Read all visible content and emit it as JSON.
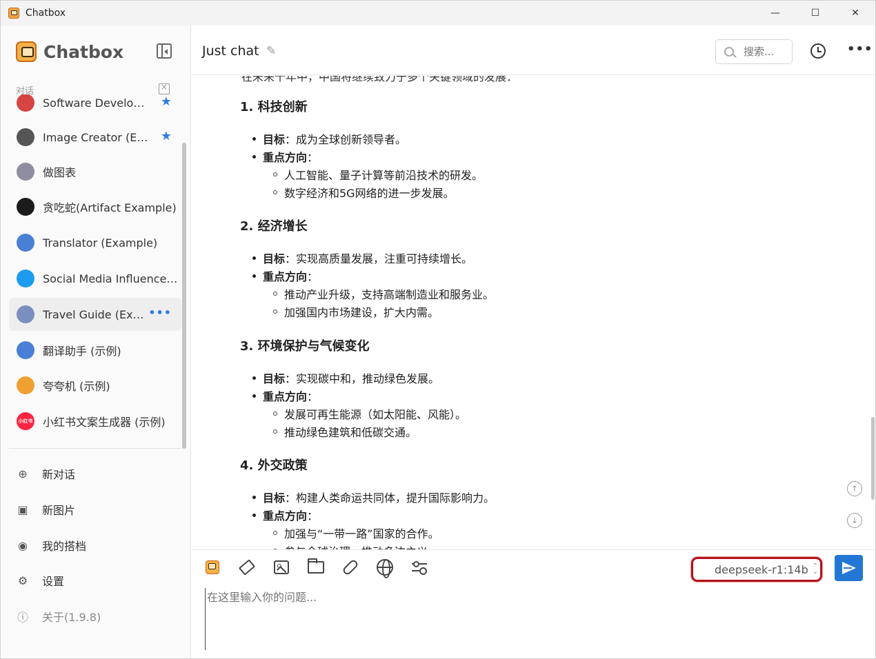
{
  "window": {
    "title": "Chatbox",
    "controls": {
      "minimize": "—",
      "maximize": "☐",
      "close": "✕"
    }
  },
  "sidebar": {
    "brand": "Chatbox",
    "section_label": "对话",
    "conversations": [
      {
        "label": "Software Develop…",
        "icon": "heart-icon",
        "color": "#d64541",
        "starred": true
      },
      {
        "label": "Image Creator (E…",
        "icon": "image-icon",
        "color": "#555555",
        "starred": true
      },
      {
        "label": "做图表",
        "icon": "chart-icon",
        "color": "#8e8ea0",
        "starred": false
      },
      {
        "label": "贪吃蛇(Artifact Example)",
        "icon": "snake-icon",
        "color": "#1b1b1b",
        "starred": false
      },
      {
        "label": "Translator (Example)",
        "icon": "translate-icon",
        "color": "#4a7fd6",
        "starred": false
      },
      {
        "label": "Social Media Influence…",
        "icon": "twitter-icon",
        "color": "#1d9bf0",
        "starred": false
      },
      {
        "label": "Travel Guide (Ex…",
        "icon": "globe-icon",
        "color": "#7a8fbf",
        "starred": false,
        "active": true,
        "more": "•••"
      },
      {
        "label": "翻译助手 (示例)",
        "icon": "translate-icon",
        "color": "#4a7fd6",
        "starred": false
      },
      {
        "label": "夸夸机 (示例)",
        "icon": "party-icon",
        "color": "#f0a030",
        "starred": false
      },
      {
        "label": "小红书文案生成器 (示例)",
        "icon": "xiaohongshu-icon",
        "color": "#ff2442",
        "starred": false,
        "badge": "小红书"
      }
    ],
    "star_glyph": "★",
    "menu": [
      {
        "label": "新对话",
        "icon": "plus-circle-icon",
        "glyph": "⊕"
      },
      {
        "label": "新图片",
        "icon": "new-image-icon",
        "glyph": "▣"
      },
      {
        "label": "我的搭档",
        "icon": "robot-icon",
        "glyph": "◉"
      },
      {
        "label": "设置",
        "icon": "gear-icon",
        "glyph": "⚙"
      },
      {
        "label": "关于(1.9.8)",
        "icon": "info-icon",
        "glyph": "ⓘ"
      }
    ]
  },
  "header": {
    "title": "Just chat",
    "edit_glyph": "✎",
    "search_placeholder": "搜索...",
    "more_glyph": "•••"
  },
  "content": {
    "clipped_line": "在未来十年中，中国将继续致力于多个关键领域的发展：",
    "sections": [
      {
        "heading": "1. 科技创新",
        "target_label": "目标",
        "target": "：成为全球创新领导者。",
        "focus_label": "重点方向",
        "focus_suffix": "：",
        "subs": [
          "人工智能、量子计算等前沿技术的研发。",
          "数字经济和5G网络的进一步发展。"
        ]
      },
      {
        "heading": "2. 经济增长",
        "target_label": "目标",
        "target": "：实现高质量发展，注重可持续增长。",
        "focus_label": "重点方向",
        "focus_suffix": "：",
        "subs": [
          "推动产业升级，支持高端制造业和服务业。",
          "加强国内市场建设，扩大内需。"
        ]
      },
      {
        "heading": "3. 环境保护与气候变化",
        "target_label": "目标",
        "target": "：实现碳中和，推动绿色发展。",
        "focus_label": "重点方向",
        "focus_suffix": "：",
        "subs": [
          "发展可再生能源（如太阳能、风能）。",
          "推动绿色建筑和低碳交通。"
        ]
      },
      {
        "heading": "4. 外交政策",
        "target_label": "目标",
        "target": "：构建人类命运共同体，提升国际影响力。",
        "focus_label": "重点方向",
        "focus_suffix": "：",
        "subs": [
          "加强与“一带一路”国家的合作。",
          "参与全球治理，推动多边主义。"
        ]
      }
    ],
    "scroll_up_glyph": "↑",
    "scroll_down_glyph": "↓"
  },
  "composer": {
    "model": "deepseek-r1:14b",
    "caret_up": "⌃",
    "caret_down": "⌄",
    "placeholder": "在这里输入你的问题..."
  },
  "colors": {
    "accent": "#2377d4",
    "highlight_border": "#b5121b",
    "star": "#2f7de1"
  }
}
